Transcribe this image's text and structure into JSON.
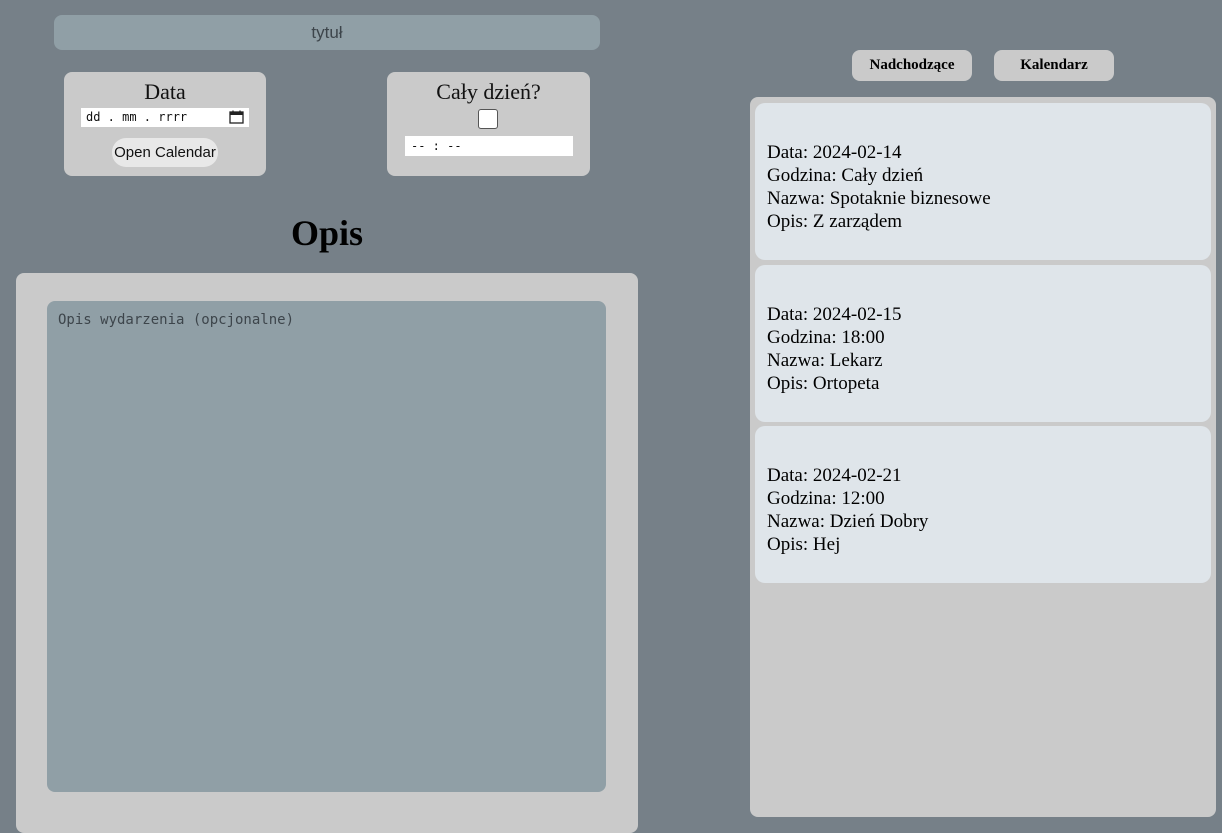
{
  "form": {
    "title_placeholder": "tytuł",
    "date": {
      "label": "Data",
      "placeholder": "dd . mm . rrrr",
      "open_calendar_label": "Open Calendar"
    },
    "all_day": {
      "label": "Cały dzień?",
      "checked": false,
      "time_placeholder": "-- : --"
    },
    "description": {
      "heading": "Opis",
      "placeholder": "Opis wydarzenia (opcjonalne)"
    }
  },
  "nav": {
    "upcoming_label": "Nadchodzące",
    "calendar_label": "Kalendarz"
  },
  "events": [
    {
      "date": "Data: 2024-02-14",
      "time": "Godzina: Cały dzień",
      "name": "Nazwa: Spotaknie biznesowe",
      "desc": "Opis: Z zarządem"
    },
    {
      "date": "Data: 2024-02-15",
      "time": "Godzina: 18:00",
      "name": "Nazwa: Lekarz",
      "desc": "Opis: Ortopeta"
    },
    {
      "date": "Data: 2024-02-21",
      "time": "Godzina: 12:00",
      "name": "Nazwa: Dzień Dobry",
      "desc": "Opis: Hej"
    }
  ],
  "colors": {
    "background": "#768088",
    "panel": "#cacaca",
    "input_fill": "#909fa6",
    "event_card": "#dfe5ea"
  },
  "icons": {
    "date_picker": "calendar-icon"
  }
}
